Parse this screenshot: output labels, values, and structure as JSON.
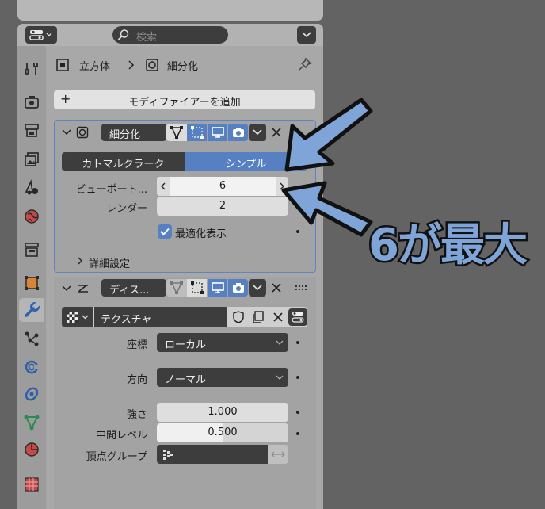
{
  "header": {
    "search_placeholder": "検索"
  },
  "breadcrumb": {
    "object": "立方体",
    "modifier": "細分化"
  },
  "add_modifier_label": "モディファイアーを追加",
  "subdivision": {
    "name": "細分化",
    "mode_catmull": "カトマルクラーク",
    "mode_simple": "シンプル",
    "viewport_label": "ビューポート...",
    "viewport_value": "6",
    "render_label": "レンダー",
    "render_value": "2",
    "optimize_label": "最適化表示",
    "advanced_label": "詳細設定"
  },
  "displace": {
    "name": "ディス...",
    "texture_name": "テクスチャ",
    "coords_label": "座標",
    "coords_value": "ローカル",
    "direction_label": "方向",
    "direction_value": "ノーマル",
    "strength_label": "強さ",
    "strength_value": "1.000",
    "midlevel_label": "中間レベル",
    "midlevel_value": "0.500",
    "vgroup_label": "頂点グループ"
  },
  "annotation": {
    "text": "6が最大",
    "color": "#7ea4d8"
  },
  "colors": {
    "accent": "#5680c2",
    "panel": "#a8a8a8",
    "background": "#636363"
  }
}
